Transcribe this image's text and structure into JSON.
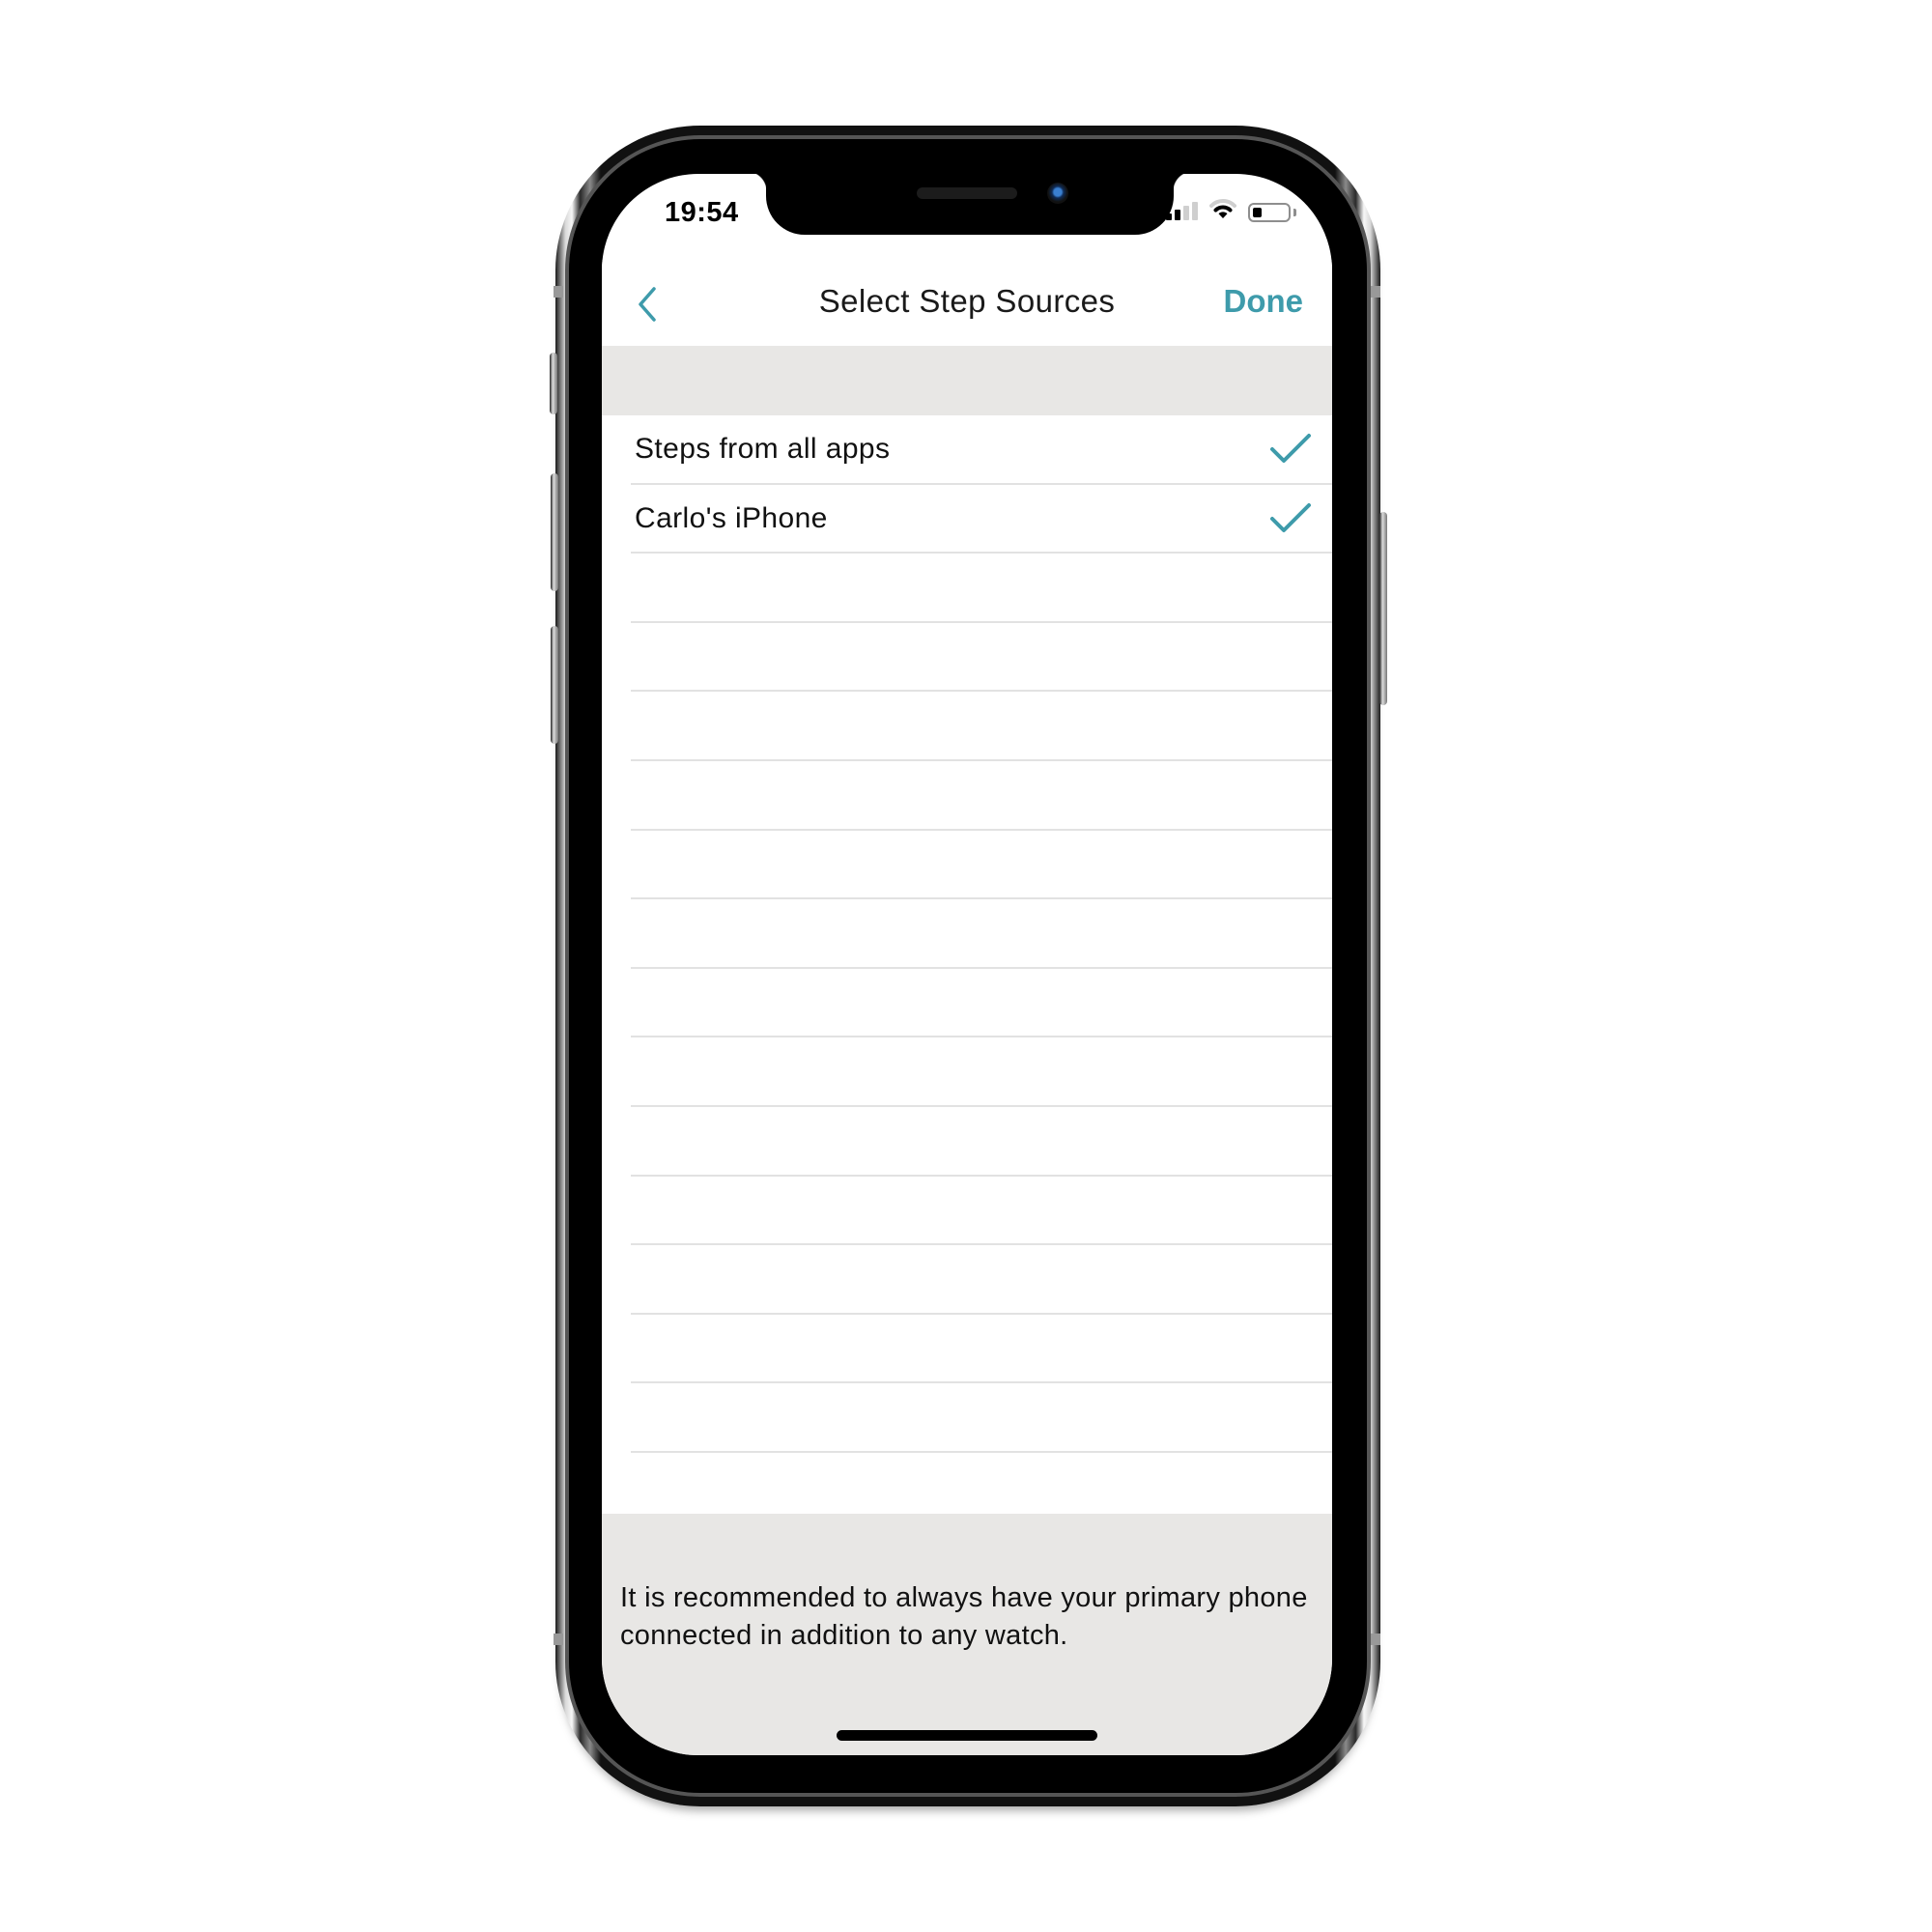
{
  "status_bar": {
    "time": "19:54",
    "signal_bars_active": 2,
    "signal_bars_total": 4,
    "wifi_icon": "wifi-icon",
    "battery_level_percent": 25
  },
  "nav": {
    "back_icon": "chevron-left-icon",
    "title": "Select Step Sources",
    "done_label": "Done"
  },
  "sources": [
    {
      "label": "Steps from all apps",
      "checked": true
    },
    {
      "label": "Carlo's iPhone",
      "checked": true
    }
  ],
  "empty_row_count": 14,
  "footer": {
    "note": "It is recommended to always have your primary phone connected in addition to any watch."
  },
  "colors": {
    "accent": "#3e9bab",
    "section_background": "#e8e7e5",
    "separator": "#e2e2e2"
  }
}
